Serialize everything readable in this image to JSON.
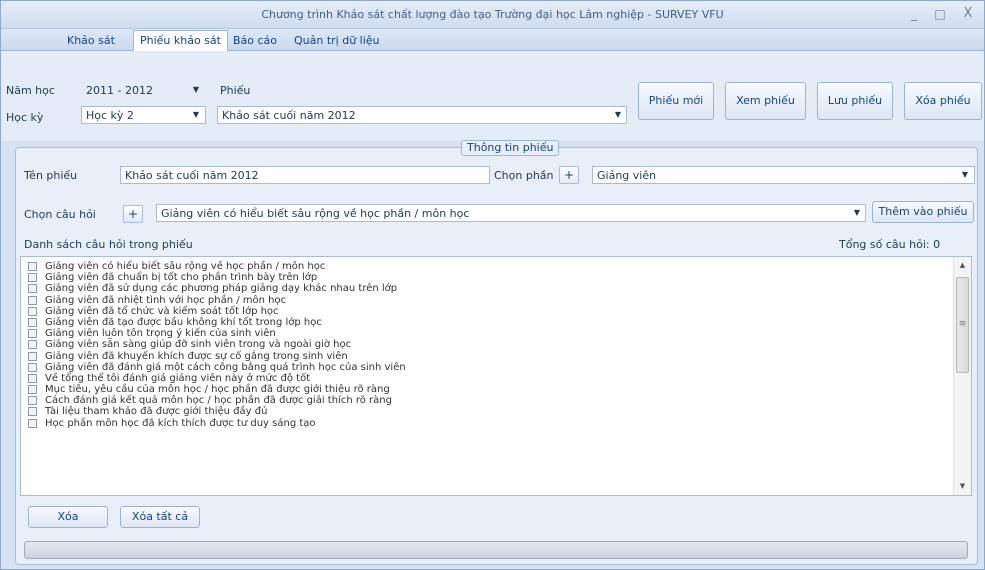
{
  "window": {
    "title": "Chương trình Khảo sát chất lượng đào tạo Trường đại học Lâm nghiệp - SURVEY VFU",
    "minimize": "_",
    "maximize": "□",
    "close": "X"
  },
  "tabs": [
    {
      "label": "Khảo sát"
    },
    {
      "label": "Phiếu khảo sát"
    },
    {
      "label": "Báo cáo"
    },
    {
      "label": "Quản trị dữ liệu"
    }
  ],
  "form": {
    "year_label": "Năm học",
    "year_value": "2011 - 2012",
    "semester_label": "Học kỳ",
    "semester_value": "Học kỳ 2",
    "form_label": "Phiếu",
    "form_value": "Khảo sát cuối năm 2012"
  },
  "toolbar": {
    "new_label": "Phiếu mới",
    "view_label": "Xem phiếu",
    "save_label": "Lưu phiếu",
    "delete_label": "Xóa phiếu"
  },
  "info": {
    "caption": "Thông tin phiếu",
    "name_label": "Tên phiếu",
    "name_value": "Khảo sát cuối năm 2012",
    "section_label": "Chọn phần",
    "section_value": "Giảng viên",
    "question_label": "Chọn câu hỏi",
    "question_value": "Giảng viên có hiểu biết sâu rộng về học phần / môn học",
    "add_label": "Thêm vào phiếu",
    "plus": "+",
    "list_title": "Danh sách câu hỏi trong phiếu",
    "total_label": "Tổng số câu hỏi:",
    "total_value": "0"
  },
  "questions": [
    "Giảng viên có hiểu biết sâu rộng về học phần / môn học",
    "Giảng viên đã chuẩn bị tốt cho phần trình bày trên lớp",
    "Giảng viên đã sử dụng các phương pháp giảng dạy khác nhau trên lớp",
    "Giảng viên đã nhiệt tình với học phần / môn học",
    "Giảng viên đã tổ chức và kiểm soát tốt lớp học",
    "Giảng viên đã tạo được bầu không khí tốt trong lớp học",
    "Giảng viên luôn tôn trọng ý kiến của sinh viên",
    "Giảng viên sẵn sàng giúp đỡ sinh viên trong và ngoài giờ học",
    "Giảng viên đã khuyến khích được sự cố gắng trong sinh viên",
    "Giảng viên đã đánh giá một cách công bằng quá trình học của sinh viên",
    "Về tổng thể tôi đánh giá giảng viên này ở mức độ tốt",
    "Mục tiêu, yêu cầu của môn học / học phần đã được giới thiệu rõ ràng",
    "Cách đánh giá kết quả môn học / học phần đã được giải thích rõ ràng",
    "Tài liệu tham khảo đã được giới thiệu đầy đủ",
    "Học phần môn học đã kích thích được tư duy sáng tạo"
  ],
  "bottom": {
    "delete_label": "Xóa",
    "delete_all_label": "Xóa tất cả"
  },
  "icons": {
    "dropdown": "▼",
    "scroll_up": "▲",
    "scroll_down": "▼",
    "grip": "≡"
  }
}
